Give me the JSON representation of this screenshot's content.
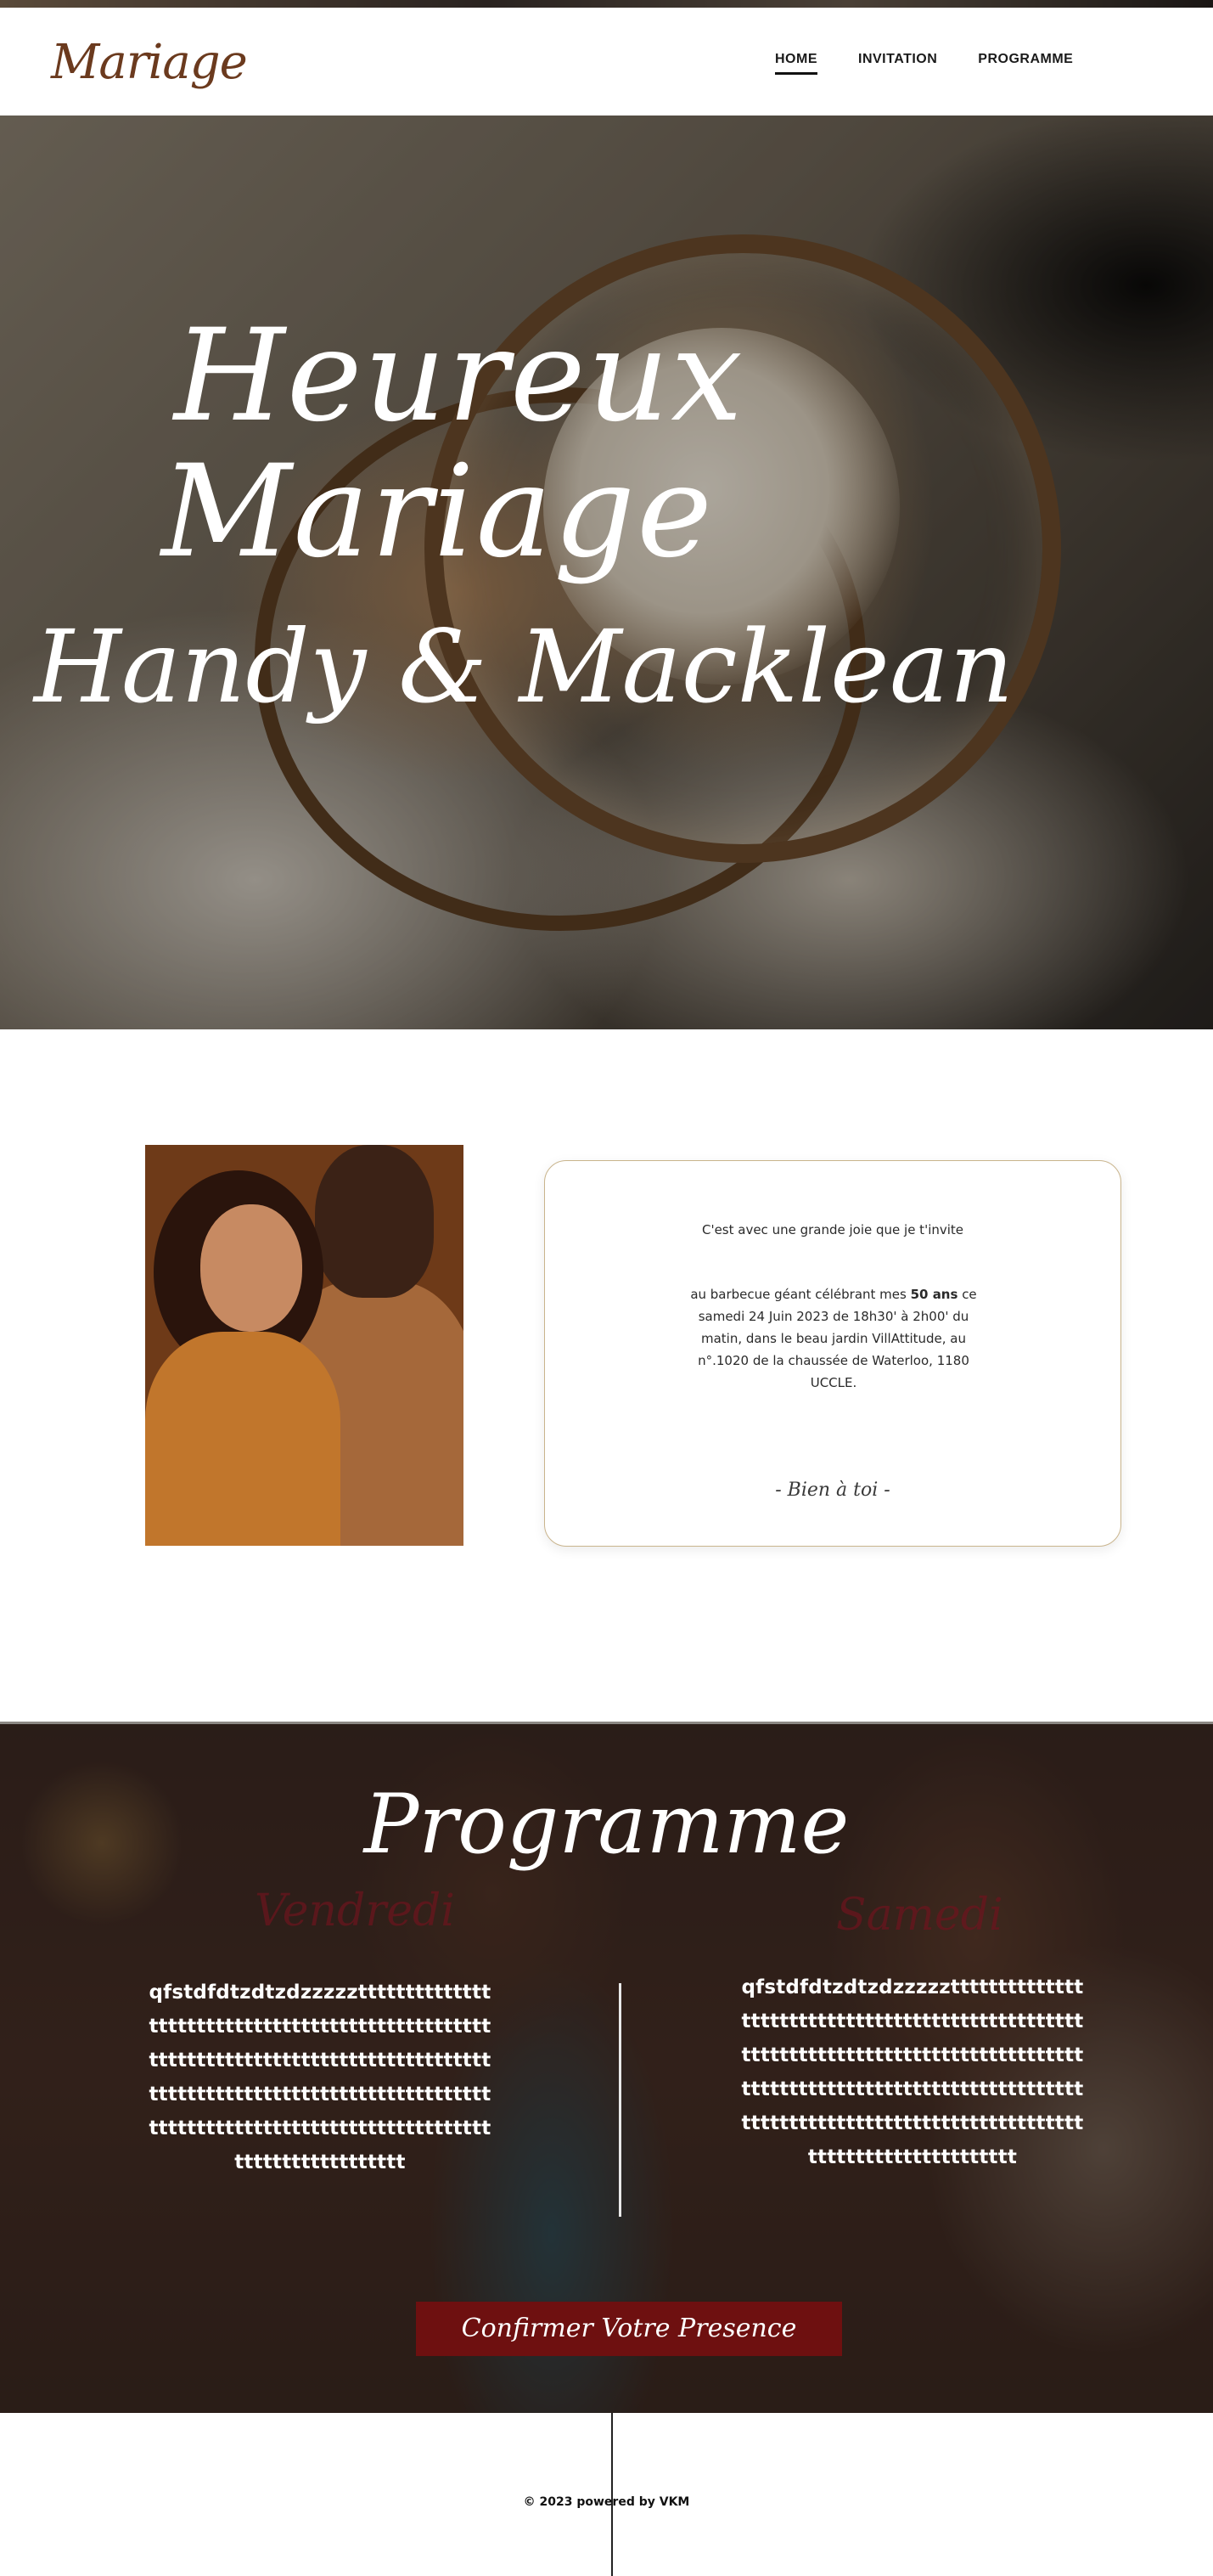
{
  "header": {
    "logo": "Mariage",
    "nav": [
      {
        "label": "HOME",
        "active": true
      },
      {
        "label": "INVITATION",
        "active": false
      },
      {
        "label": "PROGRAMME",
        "active": false
      }
    ]
  },
  "hero": {
    "line1": "Heureux",
    "line2": "Mariage",
    "line3": "Handy & Macklean"
  },
  "invitation": {
    "intro": "C'est avec une grande joie que je t'invite",
    "para_before": "au barbecue géant célébrant mes ",
    "para_bold": "50 ans",
    "para_after": " ce samedi 24 Juin 2023 de 18h30' à 2h00' du matin, dans le beau jardin VillAttitude, au n°.1020 de la chaussée de Waterloo, 1180 UCCLE.",
    "signature": "- Bien à toi -"
  },
  "programme": {
    "title": "Programme",
    "ghost_left": "Vendredi",
    "ghost_right": "Samedi",
    "col_left": "qfstdfdtzdtzdzzzzztttttttttttttttttttttttttttttttttttttttttttttttttttttttttttttttttttttttttttttttttttttttttttttttttttttttttttttttttttttttttttttttttttttttttttttttttttttttttttttttttttttttttttttttt",
    "col_right": "qfstdfdtzdtzdzzzzztttttttttttttttttttttttttttttttttttttttttttttttttttttttttttttttttttttttttttttttttttttttttttttttttttttttttttttttttttttttttttttttttttttttttttttttttttttttttttttttttttttttttttttttttttt",
    "confirm_label": "Confirmer Votre Presence"
  },
  "footer": {
    "copyright": "© 2023 powered by VKM"
  },
  "colors": {
    "logo": "#6b3a1e",
    "confirm_bg": "#6e1010",
    "card_border": "#c9b48c"
  }
}
